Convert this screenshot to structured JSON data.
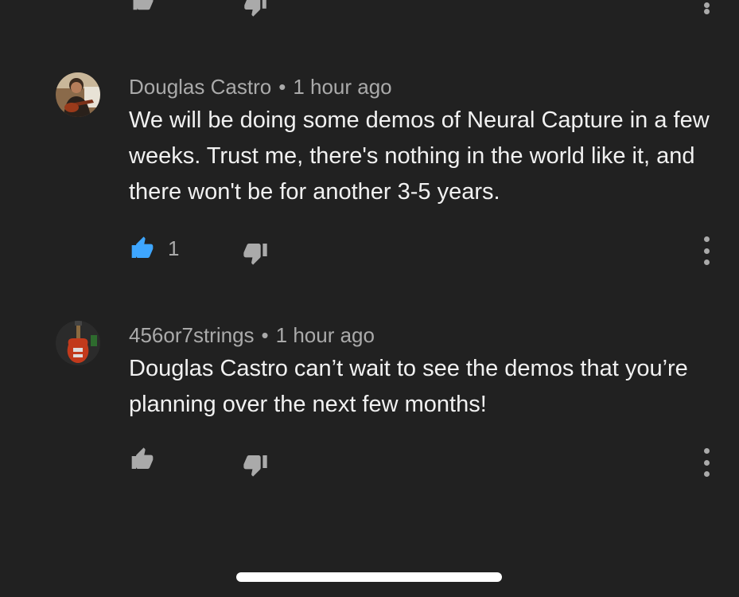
{
  "colors": {
    "background": "#212121",
    "meta_text": "#aaaaaa",
    "body_text": "#f1f1f1",
    "liked_accent": "#3ea6ff"
  },
  "comments": [
    {
      "author": "Douglas Castro",
      "separator": "•",
      "time": "1 hour ago",
      "text": "We will be doing some demos of Neural Capture in a few weeks. Trust me, there's nothing in the world like it, and there won't be for another 3-5 years.",
      "like_count": "1",
      "liked": true,
      "avatar_icon": "guitarist-avatar"
    },
    {
      "author": "456or7strings",
      "separator": "•",
      "time": "1 hour ago",
      "text": "Douglas Castro can’t wait to see the demos that you’re planning over the next few months!",
      "like_count": "",
      "liked": false,
      "avatar_icon": "bass-guitar-avatar"
    }
  ],
  "icons": {
    "like": "thumbs-up-icon",
    "dislike": "thumbs-down-icon",
    "more": "more-vertical-icon"
  }
}
